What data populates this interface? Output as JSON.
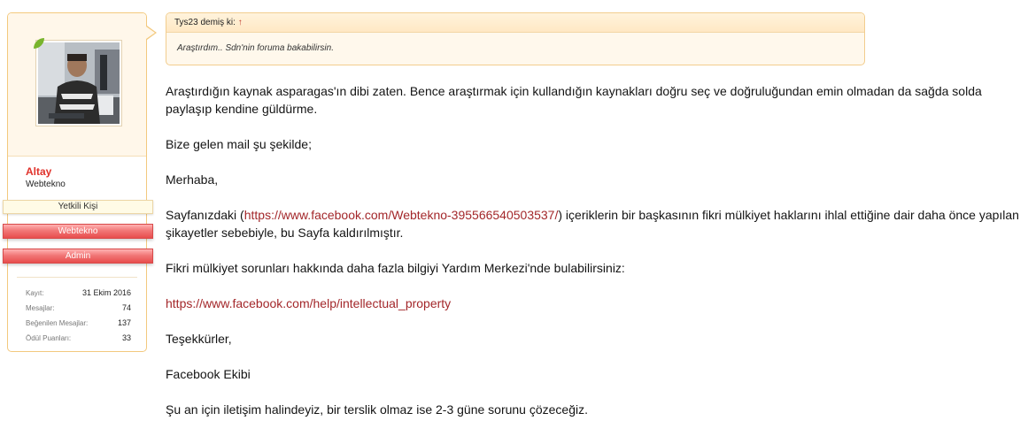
{
  "user": {
    "name": "Altay",
    "title": "Webtekno",
    "ranks": [
      "Yetkili Kişi",
      "Webtekno",
      "Admin"
    ],
    "stats": [
      {
        "label": "Kayıt:",
        "value": "31 Ekim 2016"
      },
      {
        "label": "Mesajlar:",
        "value": "74"
      },
      {
        "label": "Beğenilen Mesajlar:",
        "value": "137"
      },
      {
        "label": "Ödül Puanları:",
        "value": "33"
      }
    ]
  },
  "quote": {
    "attribution": "Tys23 demiş ki:",
    "arrow": "↑",
    "text": "Araştırdım.. Sdn'nin foruma bakabilirsin."
  },
  "post": {
    "p1": "Araştırdığın kaynak asparagas'ın dibi zaten. Bence araştırmak için kullandığın kaynakları doğru seç ve doğruluğundan emin olmadan da sağda solda paylaşıp kendine güldürme.",
    "p2": "Bize gelen mail şu şekilde;",
    "p3": "Merhaba,",
    "p4_before": "Sayfanızdaki (",
    "p4_link": "https://www.facebook.com/Webtekno-395566540503537/",
    "p4_after": ") içeriklerin bir başkasının fikri mülkiyet haklarını ihlal ettiğine dair daha önce yapılan şikayetler sebebiyle, bu Sayfa kaldırılmıştır.",
    "p5": "Fikri mülkiyet sorunları hakkında daha fazla bilgiyi Yardım Merkezi'nde bulabilirsiniz:",
    "p6_link": "https://www.facebook.com/help/intellectual_property",
    "p7": "Teşekkürler,",
    "p8": "Facebook Ekibi",
    "p9": "Şu an için iletişim halindeyiz, bir terslik olmaz ise 2-3 güne sorunu çözeceğiz."
  }
}
